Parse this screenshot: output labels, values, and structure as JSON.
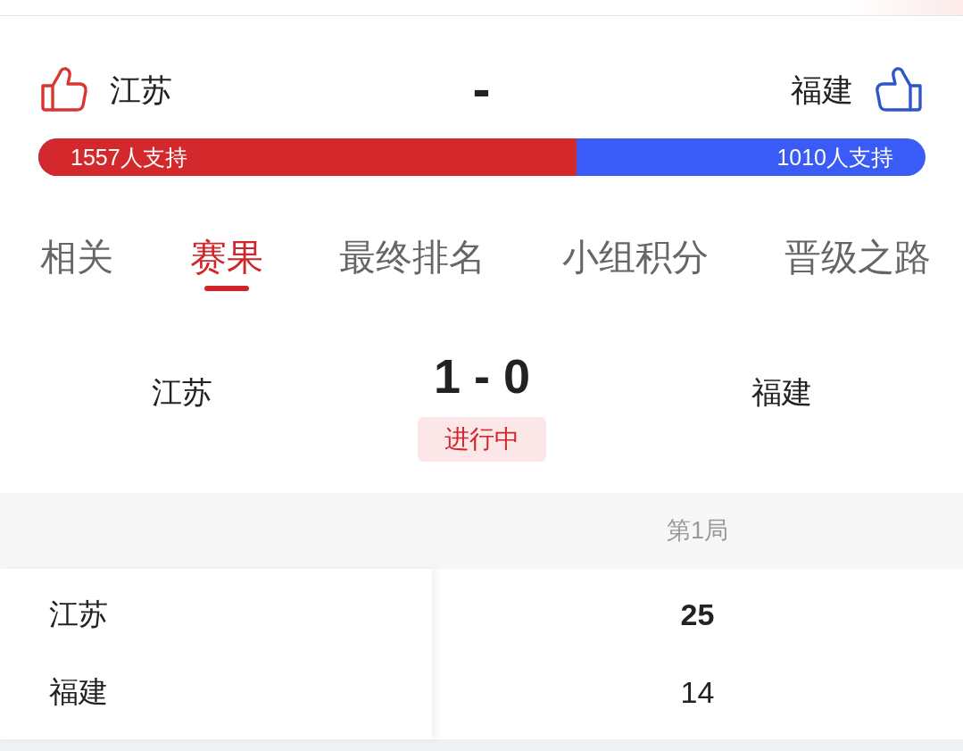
{
  "teams": {
    "home": {
      "name": "江苏"
    },
    "separator": "-",
    "away": {
      "name": "福建"
    }
  },
  "support": {
    "home_text": "1557人支持",
    "away_text": "1010人支持",
    "level": 0.607
  },
  "tabs": [
    {
      "label": "相关",
      "selected": false
    },
    {
      "label": "赛果",
      "selected": true
    },
    {
      "label": "最终排名",
      "selected": false
    },
    {
      "label": "小组积分",
      "selected": false
    },
    {
      "label": "晋级之路",
      "selected": false
    }
  ],
  "match": {
    "home": "江苏",
    "score": "1 - 0",
    "status": "进行中",
    "away": "福建"
  },
  "table": {
    "columns": [
      "第1局"
    ],
    "rows": [
      {
        "team": "江苏",
        "scores": [
          {
            "value": "25",
            "winning": true
          }
        ]
      },
      {
        "team": "福建",
        "scores": [
          {
            "value": "14",
            "winning": false
          }
        ]
      }
    ]
  }
}
